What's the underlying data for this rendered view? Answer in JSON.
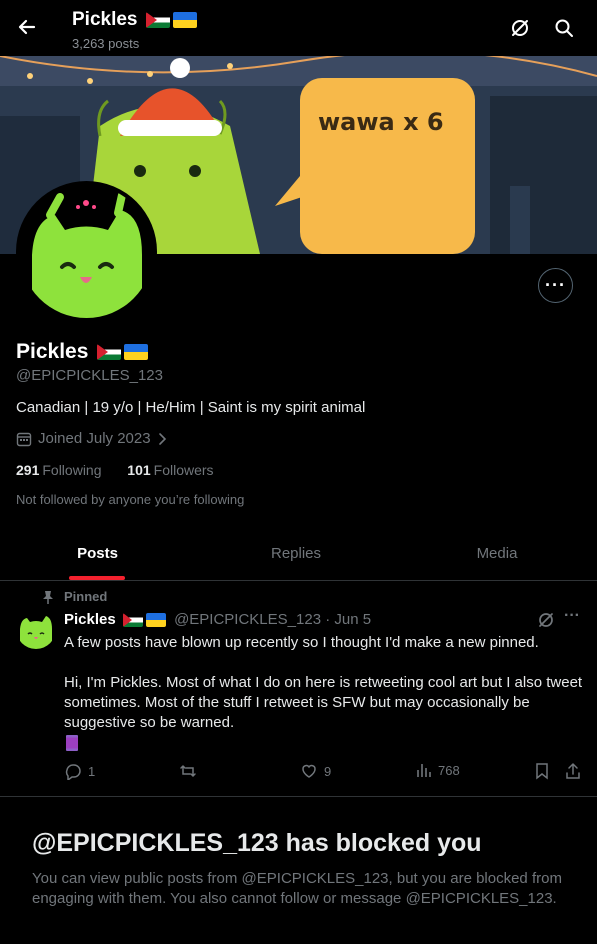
{
  "header": {
    "name": "Pickles",
    "post_count": "3,263 posts"
  },
  "banner": {
    "speech_text": "wawa x 6"
  },
  "profile": {
    "name": "Pickles",
    "handle": "@EPICPICKLES_123",
    "bio": "Canadian | 19 y/o | He/Him | Saint is my spirit animal",
    "joined": "Joined July 2023",
    "following_count": "291",
    "following_label": "Following",
    "followers_count": "101",
    "followers_label": "Followers",
    "not_followed": "Not followed by anyone you’re following",
    "more_label": "···"
  },
  "tabs": [
    {
      "label": "Posts",
      "active": true
    },
    {
      "label": "Replies",
      "active": false
    },
    {
      "label": "Media",
      "active": false
    }
  ],
  "pinned_post": {
    "pinned_label": "Pinned",
    "author": "Pickles",
    "handle_date": "@EPICPICKLES_123 · Jun 5",
    "more_label": "···",
    "line1": "A few posts have blown up recently so I thought I'd make a new pinned.",
    "line2": "Hi, I'm Pickles. Most of what I do on here is retweeting cool art but I also tweet sometimes. Most of the stuff I retweet is SFW but may occasionally be suggestive so be warned.",
    "replies": "1",
    "reposts": "",
    "likes": "9",
    "views": "768"
  },
  "blocked": {
    "title": "@EPICPICKLES_123 has blocked you",
    "text": "You can view public posts from @EPICPICKLES_123, but you are blocked from engaging with them. You also cannot follow or message @EPICPICKLES_123."
  },
  "colors": {
    "accent": "#f4212e",
    "avatar_green": "#8ee23c",
    "background": "#000000"
  },
  "icons": [
    "back-arrow-icon",
    "grok-icon",
    "search-icon",
    "more-icon",
    "calendar-icon",
    "chevron-right-icon",
    "pin-icon",
    "reply-icon",
    "repost-icon",
    "like-icon",
    "views-icon",
    "bookmark-icon",
    "share-icon"
  ]
}
